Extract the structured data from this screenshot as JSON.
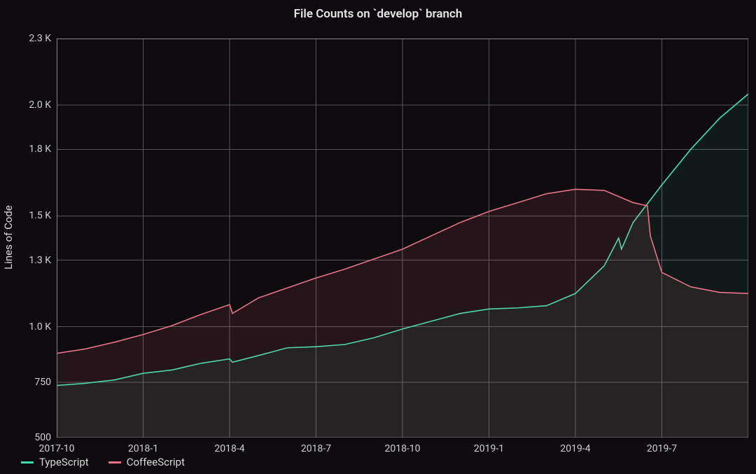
{
  "chart_data": {
    "type": "area",
    "title": "File Counts on `develop` branch",
    "ylabel": "Lines of Code",
    "xlabel": "",
    "ylim": [
      500,
      2300
    ],
    "yticks": [
      500,
      750,
      1000,
      1300,
      1500,
      1800,
      2000,
      2300
    ],
    "ytick_labels": [
      "500",
      "750",
      "1.0 K",
      "1.3 K",
      "1.5 K",
      "1.8 K",
      "2.0 K",
      "2.3 K"
    ],
    "xticks": [
      0,
      3,
      6,
      9,
      12,
      15,
      18,
      21
    ],
    "xtick_labels": [
      "2017-10",
      "2018-1",
      "2018-4",
      "2018-7",
      "2018-10",
      "2019-1",
      "2019-4",
      "2019-7"
    ],
    "xrange": [
      0,
      24
    ],
    "series": [
      {
        "name": "TypeScript",
        "color": "#3fe0b0",
        "x": [
          0,
          1,
          2,
          3,
          4,
          5,
          6,
          6.1,
          7,
          8,
          9,
          10,
          11,
          12,
          13,
          14,
          15,
          16,
          17,
          18,
          19,
          19.5,
          19.6,
          20,
          21,
          22,
          23,
          24
        ],
        "values": [
          735,
          745,
          760,
          790,
          805,
          835,
          855,
          840,
          870,
          905,
          910,
          920,
          950,
          990,
          1025,
          1060,
          1080,
          1085,
          1095,
          1150,
          1275,
          1400,
          1350,
          1470,
          1640,
          1800,
          1940,
          2050
        ]
      },
      {
        "name": "CoffeeScript",
        "color": "#e97289",
        "x": [
          0,
          1,
          2,
          3,
          4,
          5,
          6,
          6.1,
          7,
          8,
          9,
          10,
          11,
          12,
          13,
          14,
          15,
          16,
          17,
          18,
          19,
          20,
          20.5,
          20.6,
          21,
          22,
          23,
          24
        ],
        "values": [
          880,
          900,
          930,
          965,
          1005,
          1055,
          1100,
          1060,
          1130,
          1175,
          1220,
          1260,
          1305,
          1350,
          1410,
          1470,
          1520,
          1560,
          1600,
          1620,
          1615,
          1560,
          1545,
          1410,
          1245,
          1180,
          1155,
          1150
        ]
      }
    ],
    "legend_position": "bottom-left"
  }
}
